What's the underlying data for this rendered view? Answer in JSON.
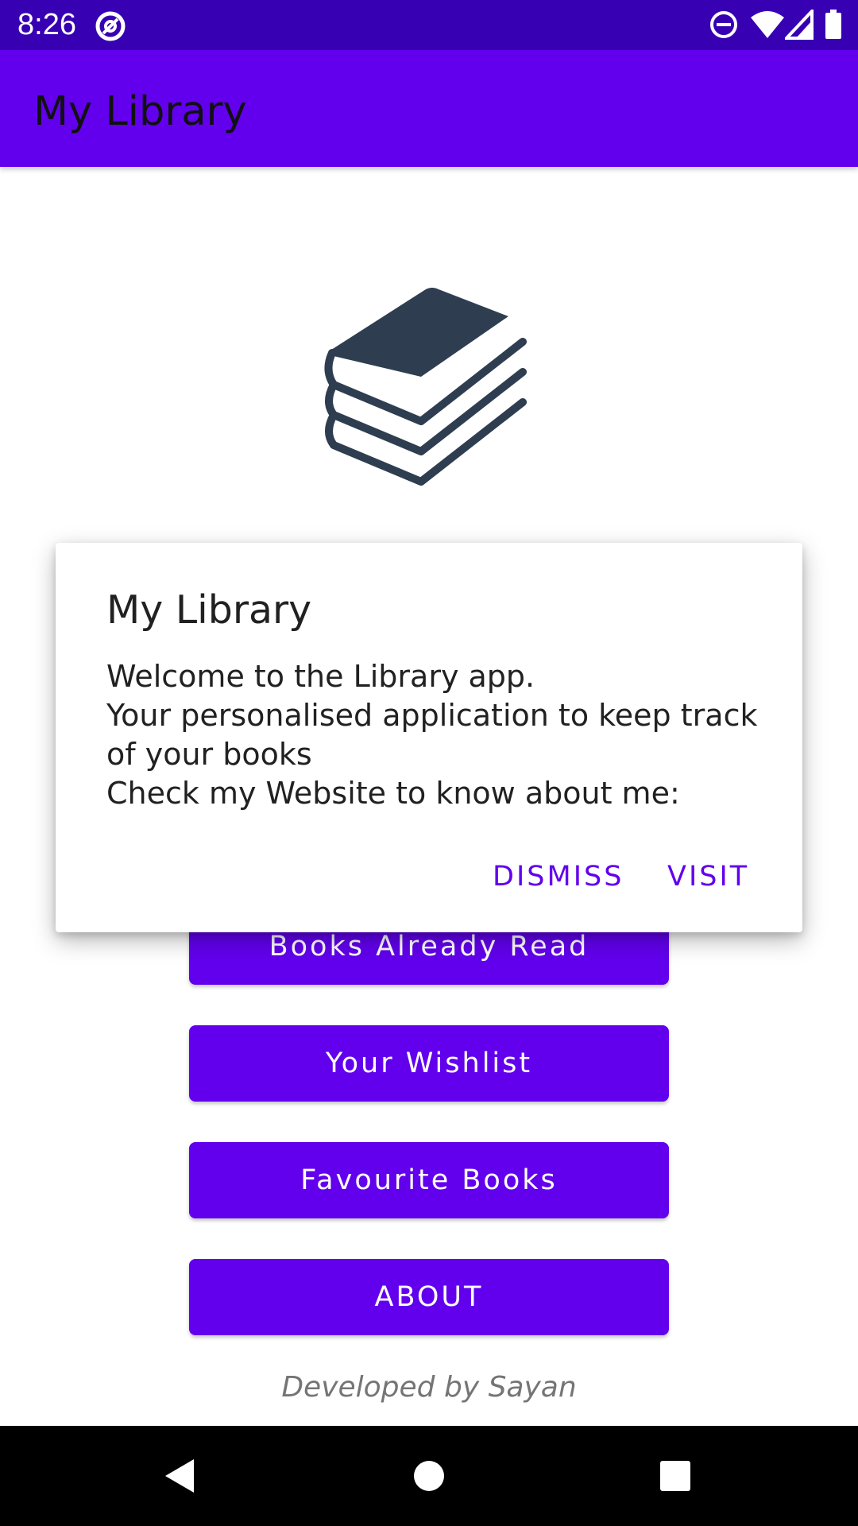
{
  "status_bar": {
    "time": "8:26",
    "icons": [
      "at-sign-icon",
      "do-not-disturb-icon",
      "wifi-icon",
      "cell-signal-icon",
      "battery-icon"
    ]
  },
  "app_bar": {
    "title": "My Library"
  },
  "logo": {
    "icon": "books-stack-icon",
    "color": "#2e3e50"
  },
  "buttons": {
    "already_read": "Books Already Read",
    "wishlist": "Your Wishlist",
    "favourites": "Favourite Books",
    "about": "ABOUT"
  },
  "footer": {
    "text": "Developed by Sayan"
  },
  "dialog": {
    "title": "My Library",
    "message": "Welcome to the Library app.\nYour personalised application to keep track of your books\nCheck my Website to know about me:",
    "dismiss_label": "DISMISS",
    "visit_label": "VISIT"
  },
  "nav_bar": {
    "icons": [
      "back-icon",
      "home-icon",
      "recents-icon"
    ]
  },
  "colors": {
    "primary": "#6200ee",
    "primary_dark": "#3700b3"
  }
}
